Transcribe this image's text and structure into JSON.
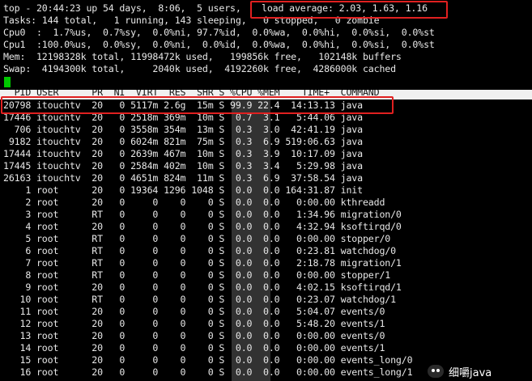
{
  "summary": {
    "uptime": "top - 20:44:23 up 54 days,  8:06,  5 users,",
    "load": "load average: 2.03, 1.63, 1.16",
    "tasks": "Tasks: 144 total,   1 running, 143 sleeping,   0 stopped,   0 zombie",
    "cpu0": "Cpu0  :  1.7%us,  0.7%sy,  0.0%ni, 97.7%id,  0.0%wa,  0.0%hi,  0.0%si,  0.0%st",
    "cpu1": "Cpu1  :100.0%us,  0.0%sy,  0.0%ni,  0.0%id,  0.0%wa,  0.0%hi,  0.0%si,  0.0%st",
    "mem": "Mem:  12198328k total, 11998472k used,   199856k free,   102148k buffers",
    "swap": "Swap:  4194300k total,     2040k used,  4192260k free,  4286000k cached"
  },
  "columns_header": "  PID USER      PR  NI  VIRT  RES  SHR S %CPU %MEM    TIME+  COMMAND",
  "processes": [
    "20798 itouchtv  20   0 5117m 2.6g  15m S 99.9 22.4  14:13.13 java",
    "17446 itouchtv  20   0 2518m 369m  10m S  0.7  3.1   5:44.06 java",
    "  706 itouchtv  20   0 3558m 354m  13m S  0.3  3.0  42:41.19 java",
    " 9182 itouchtv  20   0 6024m 821m  75m S  0.3  6.9 519:06.63 java",
    "17444 itouchtv  20   0 2639m 467m  10m S  0.3  3.9  10:17.09 java",
    "17445 itouchtv  20   0 2584m 402m  10m S  0.3  3.4   5:29.98 java",
    "26163 itouchtv  20   0 4651m 824m  11m S  0.3  6.9  37:58.54 java",
    "    1 root      20   0 19364 1296 1048 S  0.0  0.0 164:31.87 init",
    "    2 root      20   0     0    0    0 S  0.0  0.0   0:00.00 kthreadd",
    "    3 root      RT   0     0    0    0 S  0.0  0.0   1:34.96 migration/0",
    "    4 root      20   0     0    0    0 S  0.0  0.0   4:32.94 ksoftirqd/0",
    "    5 root      RT   0     0    0    0 S  0.0  0.0   0:00.00 stopper/0",
    "    6 root      RT   0     0    0    0 S  0.0  0.0   0:23.81 watchdog/0",
    "    7 root      RT   0     0    0    0 S  0.0  0.0   2:18.78 migration/1",
    "    8 root      RT   0     0    0    0 S  0.0  0.0   0:00.00 stopper/1",
    "    9 root      20   0     0    0    0 S  0.0  0.0   4:02.15 ksoftirqd/1",
    "   10 root      RT   0     0    0    0 S  0.0  0.0   0:23.07 watchdog/1",
    "   11 root      20   0     0    0    0 S  0.0  0.0   5:04.07 events/0",
    "   12 root      20   0     0    0    0 S  0.0  0.0   5:48.20 events/1",
    "   13 root      20   0     0    0    0 S  0.0  0.0   0:00.00 events/0",
    "   14 root      20   0     0    0    0 S  0.0  0.0   0:00.00 events/1",
    "   15 root      20   0     0    0    0 S  0.0  0.0   0:00.00 events_long/0",
    "   16 root      20   0     0    0    0 S  0.0  0.0   0:00.00 events_long/1"
  ],
  "watermark": {
    "text": "细嚼java",
    "icon": "wechat-icon"
  },
  "colors": {
    "background": "#000000",
    "text": "#e8e8e8",
    "cursor": "#00c800",
    "highlight": "#e02020",
    "header_bg": "#f0f0f0"
  }
}
